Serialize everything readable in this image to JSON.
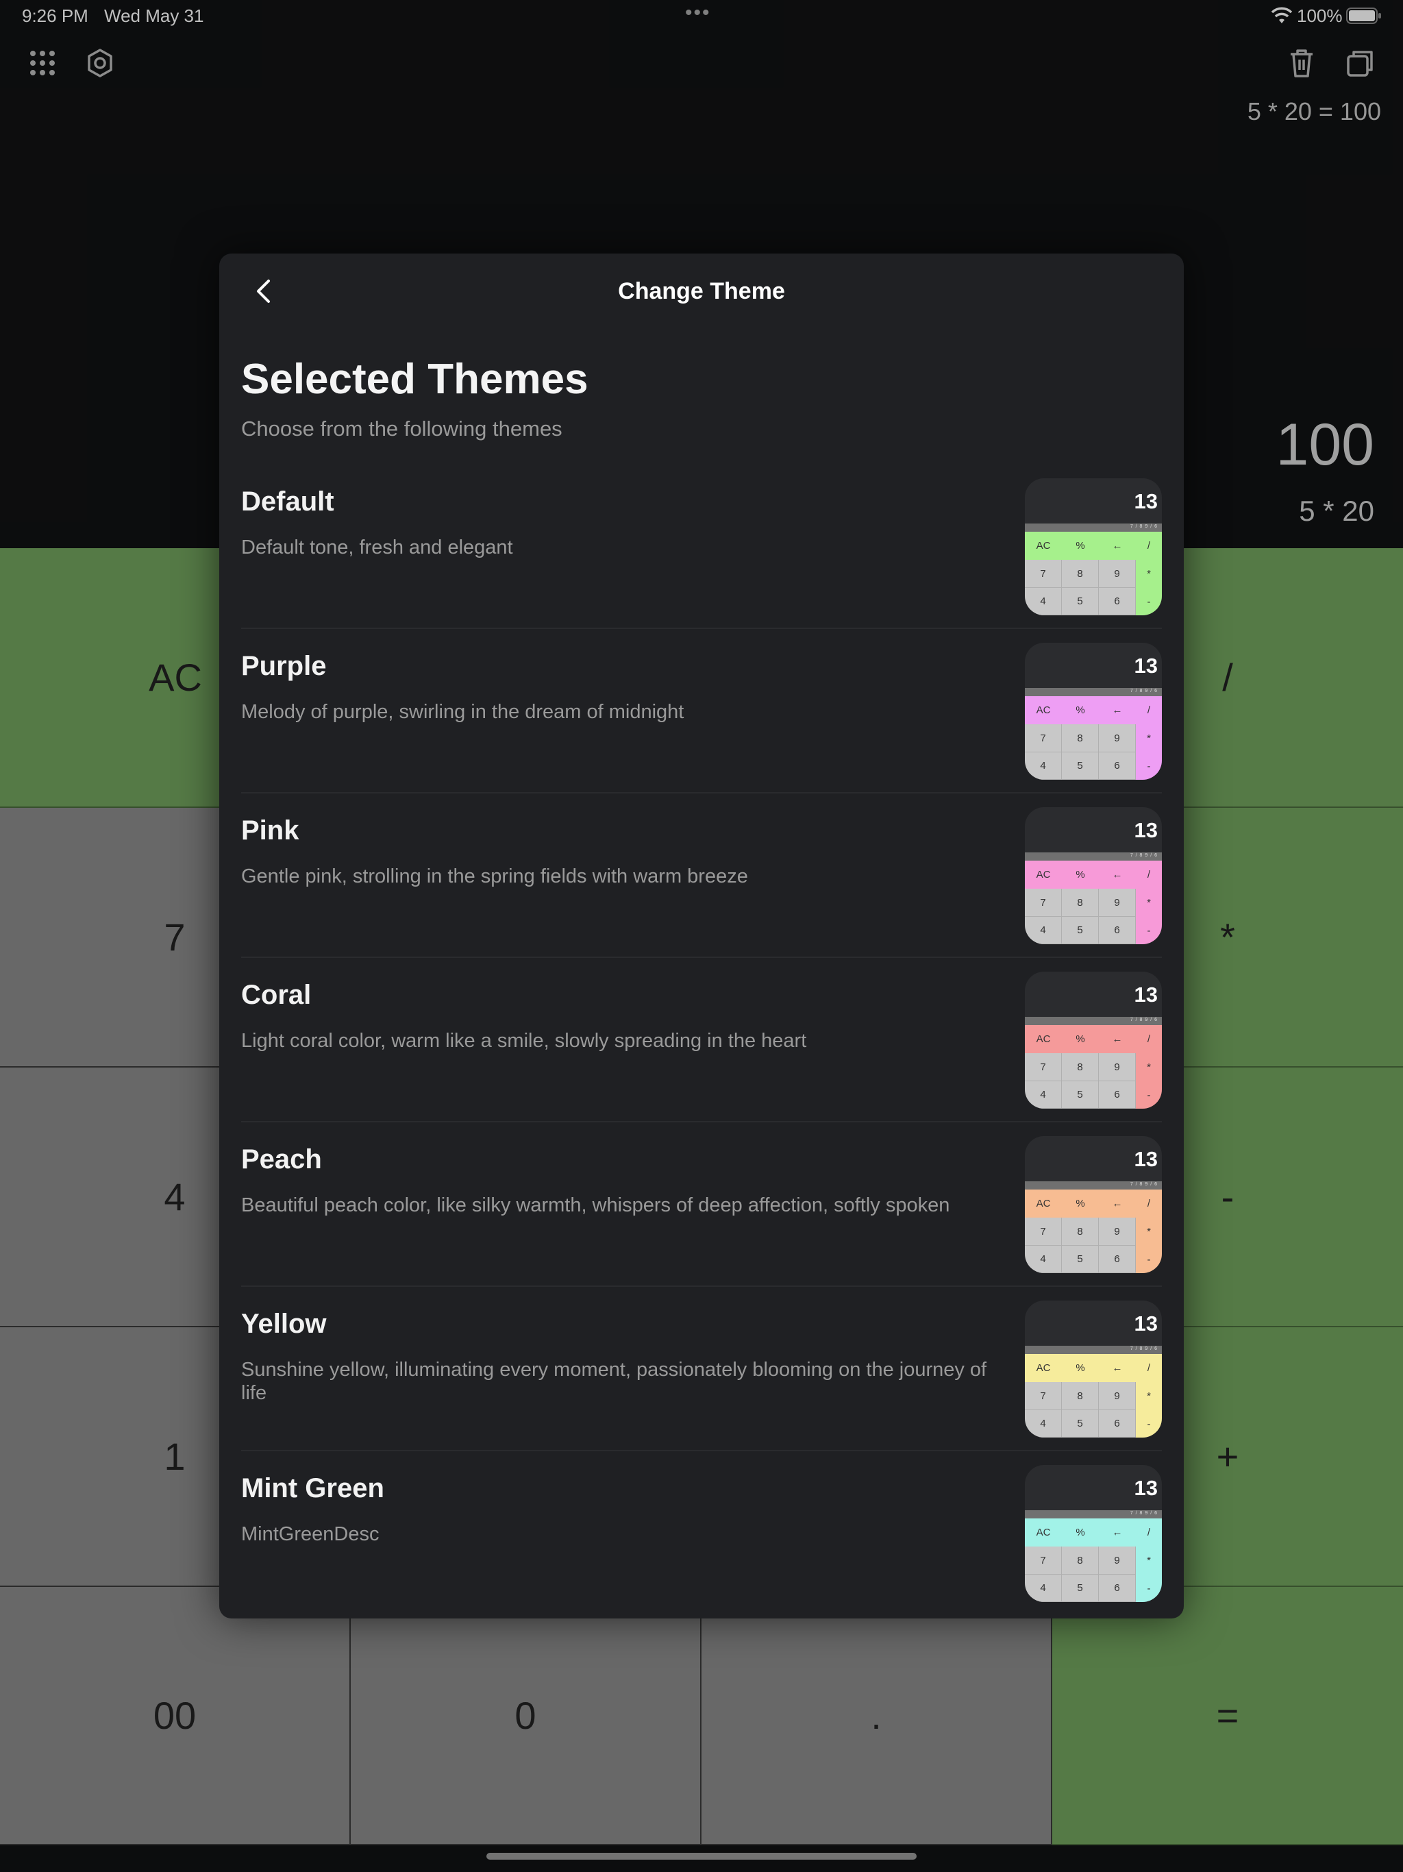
{
  "status_bar": {
    "time": "9:26 PM",
    "date": "Wed May 31",
    "multitask_dots": "•••",
    "battery_percent": "100%",
    "wifi_icon": "wifi-icon",
    "battery_icon": "battery-icon"
  },
  "toolbar": {
    "left_icons": [
      "grid-icon",
      "gear-icon"
    ],
    "right_icons": [
      "trash-icon",
      "copy-icon"
    ]
  },
  "history": {
    "line": "5 * 20 = 100"
  },
  "display": {
    "result": "100",
    "expression": "5 * 20"
  },
  "keypad": {
    "accent_color": "#72a35e",
    "number_color": "#8b8b8b",
    "keys": {
      "ac": "AC",
      "divide": "/",
      "seven": "7",
      "multiply": "*",
      "four": "4",
      "minus": "-",
      "one": "1",
      "plus": "+",
      "double_zero": "00",
      "zero": "0",
      "dot": ".",
      "equals": "="
    }
  },
  "modal": {
    "title": "Change Theme",
    "back_icon": "chevron-left-icon",
    "section_title": "Selected Themes",
    "section_subtitle": "Choose from the following themes",
    "themes": [
      {
        "name": "Default",
        "description": "Default tone, fresh and elegant",
        "color": "#a6f08c"
      },
      {
        "name": "Purple",
        "description": "Melody of purple, swirling in the dream of midnight",
        "color": "#ee9ef4"
      },
      {
        "name": "Pink",
        "description": "Gentle pink, strolling in the spring fields with warm breeze",
        "color": "#f79ad8"
      },
      {
        "name": "Coral",
        "description": "Light coral color, warm like a smile, slowly spreading in the heart",
        "color": "#f59a9a"
      },
      {
        "name": "Peach",
        "description": "Beautiful peach color, like silky warmth, whispers of deep affection, softly spoken",
        "color": "#f7bc92"
      },
      {
        "name": "Yellow",
        "description": "Sunshine yellow, illuminating every moment, passionately blooming on the journey of life",
        "color": "#f6ec9c"
      },
      {
        "name": "Mint Green",
        "description": "MintGreenDesc",
        "color": "#a2f2e8"
      }
    ],
    "preview": {
      "display_number": "13",
      "bar_text": "7 / 8 9 / 6",
      "keys": [
        "AC",
        "%",
        "←",
        "/",
        "7",
        "8",
        "9",
        "*",
        "4",
        "5",
        "6",
        "-"
      ]
    }
  }
}
